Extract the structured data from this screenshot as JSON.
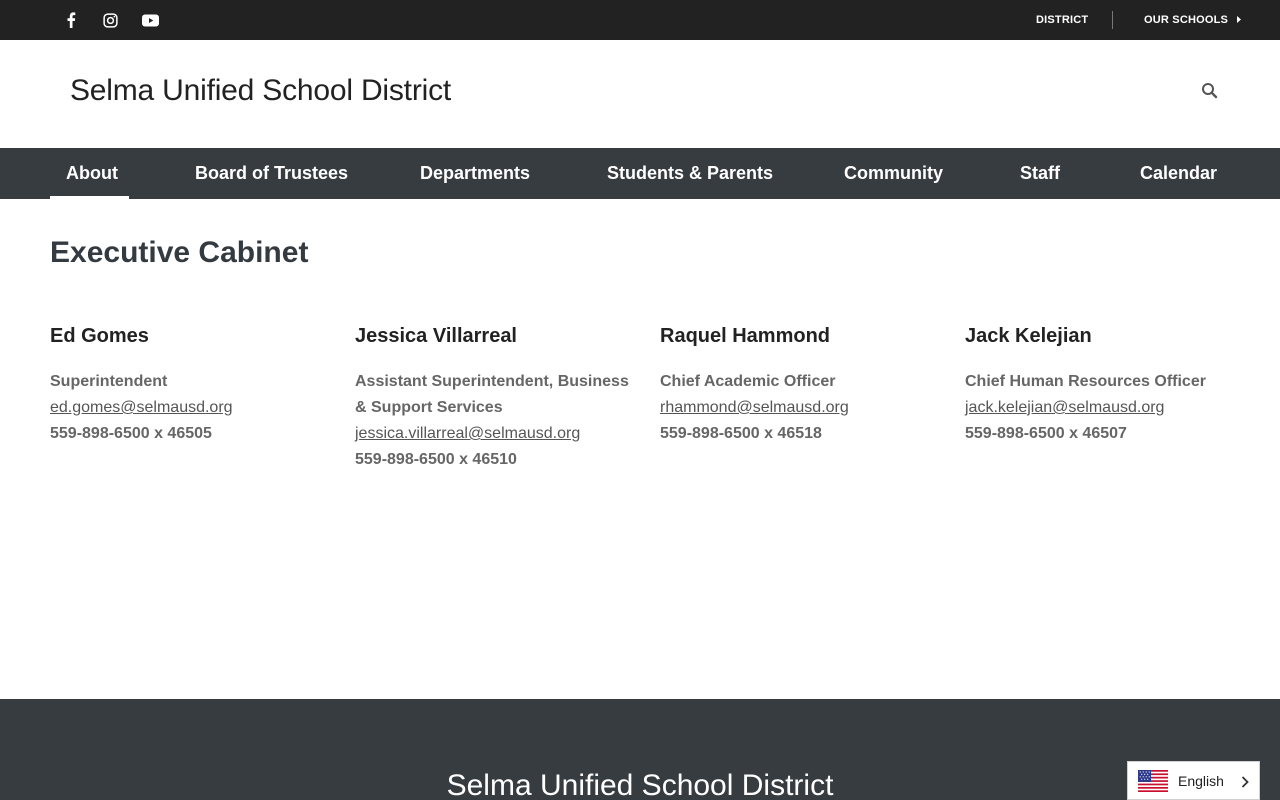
{
  "topbar": {
    "social": [
      "facebook-icon",
      "instagram-icon",
      "youtube-icon"
    ],
    "links": [
      "DISTRICT",
      "OUR SCHOOLS"
    ]
  },
  "header": {
    "title": "Selma Unified School District",
    "search_icon": "search-icon"
  },
  "nav": {
    "items": [
      "About",
      "Board of Trustees",
      "Departments",
      "Students & Parents",
      "Community",
      "Staff",
      "Calendar"
    ],
    "active": "About"
  },
  "main": {
    "title": "Executive Cabinet",
    "people": [
      {
        "name": "Ed Gomes",
        "role": "Superintendent",
        "email": "ed.gomes@selmausd.org",
        "phone": "559-898-6500 x 46505"
      },
      {
        "name": "Jessica Villarreal",
        "role": "Assistant Superintendent, Business & Support Services",
        "email": "jessica.villarreal@selmausd.org",
        "phone": "559-898-6500 x 46510"
      },
      {
        "name": "Raquel Hammond",
        "role": "Chief Academic Officer",
        "email": "rhammond@selmausd.org",
        "phone": "559-898-6500 x 46518"
      },
      {
        "name": "Jack Kelejian",
        "role": "Chief Human Resources Officer",
        "email": "jack.kelejian@selmausd.org",
        "phone": "559-898-6500 x 46507"
      }
    ]
  },
  "footer": {
    "title": "Selma Unified School District"
  },
  "language": {
    "label": "English",
    "flag": "us-flag-icon"
  },
  "colors": {
    "topbar": "#222222",
    "nav": "#373c41",
    "footer": "#373c41"
  }
}
